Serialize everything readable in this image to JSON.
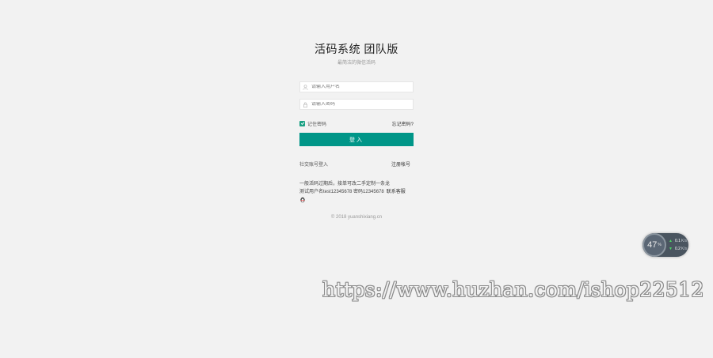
{
  "login": {
    "title": "活码系统 团队版",
    "subtitle": "最简洁的微信活码",
    "username_placeholder": "请输入用户名",
    "password_placeholder": "请输入密码",
    "remember_label": "记住密码",
    "remember_checked": true,
    "forgot_label": "忘记密码?",
    "submit_label": "登入",
    "social_login_label": "社交账号登入",
    "register_label": "注册帐号"
  },
  "notes": {
    "line1": "一般活码过期后，接单可改二手定制一条龙",
    "line2": "测试用户名test12345678 密码12345678",
    "contact_label": "联系客服",
    "qq_icon": "qq-penguin-icon"
  },
  "footer": {
    "copyright": "© 2018 yuanshixiang.cn"
  },
  "speed_widget": {
    "percent": "47",
    "percent_unit": "%",
    "upload_rate": "0.1",
    "upload_unit": "K/s",
    "download_rate": "0.2",
    "download_unit": "K/s",
    "upload_arrow_color": "#4cd964",
    "download_arrow_color": "#4cd964"
  },
  "colors": {
    "accent": "#009688",
    "checkbox": "#1aa083",
    "background": "#f2f2f2"
  },
  "watermark": {
    "text": "https://www.huzhan.com/ishop22512"
  }
}
